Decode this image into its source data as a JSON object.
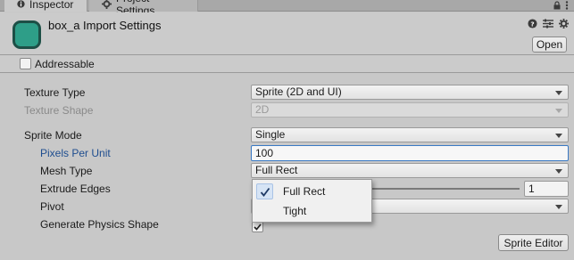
{
  "tabs": [
    {
      "label": "Inspector",
      "icon": "info-icon"
    },
    {
      "label": "Project Settings",
      "icon": "gear-icon"
    }
  ],
  "header": {
    "title": "box_a Import Settings",
    "open_label": "Open",
    "asset_color": "#2e9e88",
    "icons": [
      "help-icon",
      "presets-icon",
      "settings-icon"
    ]
  },
  "addressable": {
    "label": "Addressable",
    "checked": false
  },
  "fields": {
    "texture_type": {
      "label": "Texture Type",
      "value": "Sprite (2D and UI)"
    },
    "texture_shape": {
      "label": "Texture Shape",
      "value": "2D"
    },
    "sprite_mode": {
      "label": "Sprite Mode",
      "value": "Single"
    },
    "pixels_per_unit": {
      "label": "Pixels Per Unit",
      "value": "100"
    },
    "mesh_type": {
      "label": "Mesh Type",
      "value": "Full Rect"
    },
    "extrude_edges": {
      "label": "Extrude Edges",
      "value": "1"
    },
    "pivot": {
      "label": "Pivot",
      "value": ""
    },
    "generate_physics_shape": {
      "label": "Generate Physics Shape",
      "checked": true
    }
  },
  "mesh_type_menu": {
    "options": [
      "Full Rect",
      "Tight"
    ],
    "selected": "Full Rect"
  },
  "sprite_editor_label": "Sprite Editor"
}
